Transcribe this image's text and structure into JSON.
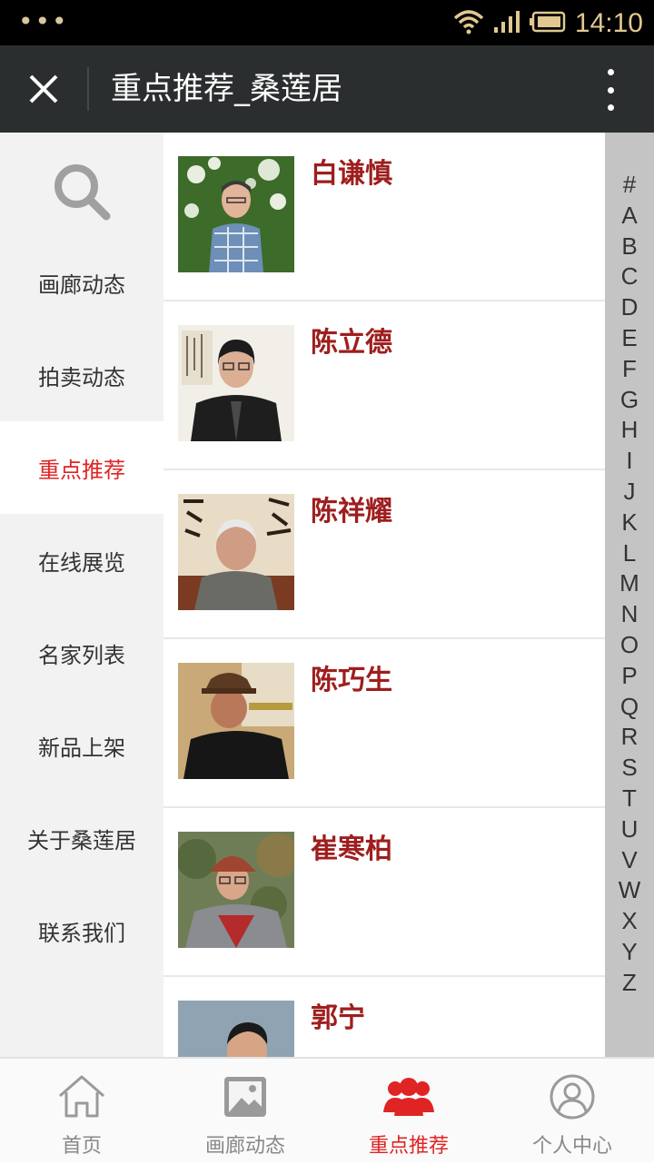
{
  "status_bar": {
    "time": "14:10",
    "icons": [
      "wifi-icon",
      "signal-icon",
      "battery-icon"
    ]
  },
  "title_bar": {
    "title": "重点推荐_桑莲居",
    "close_icon": "close-icon",
    "more_icon": "more-vertical-icon"
  },
  "sidebar": {
    "search_icon": "search-icon",
    "items": [
      {
        "label": "画廊动态"
      },
      {
        "label": "拍卖动态"
      },
      {
        "label": "重点推荐"
      },
      {
        "label": "在线展览"
      },
      {
        "label": "名家列表"
      },
      {
        "label": "新品上架"
      },
      {
        "label": "关于桑莲居"
      },
      {
        "label": "联系我们"
      }
    ],
    "active_item": "重点推荐"
  },
  "artists": [
    {
      "name": "白谦慎"
    },
    {
      "name": "陈立德"
    },
    {
      "name": "陈祥耀"
    },
    {
      "name": "陈巧生"
    },
    {
      "name": "崔寒柏"
    },
    {
      "name": "郭宁"
    }
  ],
  "alphabet_index": [
    "#",
    "A",
    "B",
    "C",
    "D",
    "E",
    "F",
    "G",
    "H",
    "I",
    "J",
    "K",
    "L",
    "M",
    "N",
    "O",
    "P",
    "Q",
    "R",
    "S",
    "T",
    "U",
    "V",
    "W",
    "X",
    "Y",
    "Z"
  ],
  "bottom_nav": {
    "items": [
      {
        "label": "首页",
        "icon": "home-icon"
      },
      {
        "label": "画廊动态",
        "icon": "gallery-icon"
      },
      {
        "label": "重点推荐",
        "icon": "users-icon"
      },
      {
        "label": "个人中心",
        "icon": "profile-icon"
      }
    ],
    "active_item": "重点推荐"
  },
  "colors": {
    "accent": "#e02424",
    "artist_name": "#9e1e1e",
    "title_bar_bg": "#2b2e2f",
    "sidebar_bg": "#f2f2f2",
    "index_bg": "#c4c4c4"
  }
}
